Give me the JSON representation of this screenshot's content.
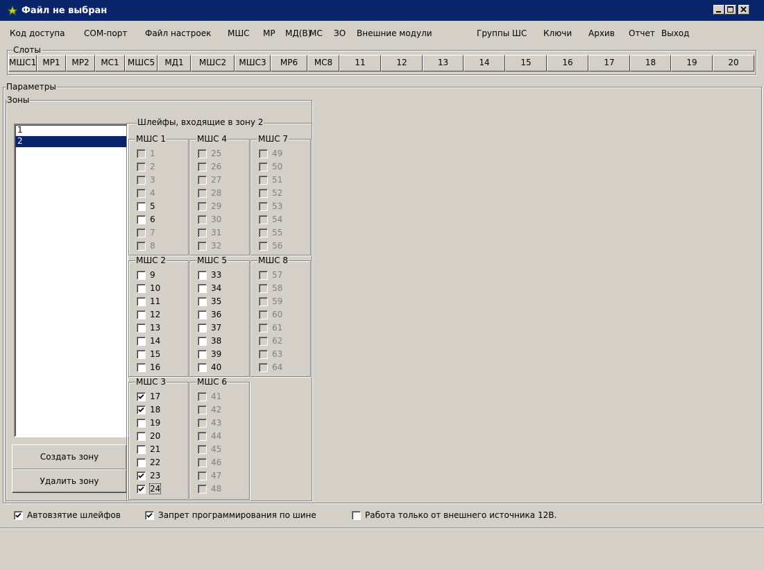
{
  "window": {
    "title": "Файл не выбран"
  },
  "menu": [
    "Код доступа",
    "COM-порт",
    "Файл настроек",
    "МШС",
    "МР",
    "МД(В)",
    "МС",
    "ЗО",
    "Внешние модули",
    "Группы ШС",
    "Ключи",
    "Архив",
    "Отчет",
    "Выход"
  ],
  "slots_title": "Слоты",
  "slots": [
    "МШС1",
    "МР1",
    "МР2",
    "МС1",
    "МШС5",
    "МД1",
    "МШС2",
    "МШС3",
    "МР6",
    "МС8",
    "11",
    "12",
    "13",
    "14",
    "15",
    "16",
    "17",
    "18",
    "19",
    "20"
  ],
  "params_title": "Параметры",
  "zones_title": "Зоны",
  "zone_list": {
    "items": [
      "1",
      "2"
    ],
    "selected": 1
  },
  "create_zone": "Создать зону",
  "delete_zone": "Удалить зону",
  "loops_title": "Шлейфы, входящие в зону 2",
  "modules": [
    {
      "name": "МШС 1",
      "loops": [
        {
          "n": "1",
          "enabled": false,
          "checked": false
        },
        {
          "n": "2",
          "enabled": false,
          "checked": false
        },
        {
          "n": "3",
          "enabled": false,
          "checked": false
        },
        {
          "n": "4",
          "enabled": false,
          "checked": false
        },
        {
          "n": "5",
          "enabled": true,
          "checked": false
        },
        {
          "n": "6",
          "enabled": true,
          "checked": false
        },
        {
          "n": "7",
          "enabled": false,
          "checked": false
        },
        {
          "n": "8",
          "enabled": false,
          "checked": false
        }
      ]
    },
    {
      "name": "МШС 4",
      "loops": [
        {
          "n": "25",
          "enabled": false,
          "checked": false
        },
        {
          "n": "26",
          "enabled": false,
          "checked": false
        },
        {
          "n": "27",
          "enabled": false,
          "checked": false
        },
        {
          "n": "28",
          "enabled": false,
          "checked": false
        },
        {
          "n": "29",
          "enabled": false,
          "checked": false
        },
        {
          "n": "30",
          "enabled": false,
          "checked": false
        },
        {
          "n": "31",
          "enabled": false,
          "checked": false
        },
        {
          "n": "32",
          "enabled": false,
          "checked": false
        }
      ]
    },
    {
      "name": "МШС 7",
      "loops": [
        {
          "n": "49",
          "enabled": false,
          "checked": false
        },
        {
          "n": "50",
          "enabled": false,
          "checked": false
        },
        {
          "n": "51",
          "enabled": false,
          "checked": false
        },
        {
          "n": "52",
          "enabled": false,
          "checked": false
        },
        {
          "n": "53",
          "enabled": false,
          "checked": false
        },
        {
          "n": "54",
          "enabled": false,
          "checked": false
        },
        {
          "n": "55",
          "enabled": false,
          "checked": false
        },
        {
          "n": "56",
          "enabled": false,
          "checked": false
        }
      ]
    },
    {
      "name": "МШС 2",
      "loops": [
        {
          "n": "9",
          "enabled": true,
          "checked": false
        },
        {
          "n": "10",
          "enabled": true,
          "checked": false
        },
        {
          "n": "11",
          "enabled": true,
          "checked": false
        },
        {
          "n": "12",
          "enabled": true,
          "checked": false
        },
        {
          "n": "13",
          "enabled": true,
          "checked": false
        },
        {
          "n": "14",
          "enabled": true,
          "checked": false
        },
        {
          "n": "15",
          "enabled": true,
          "checked": false
        },
        {
          "n": "16",
          "enabled": true,
          "checked": false
        }
      ]
    },
    {
      "name": "МШС 5",
      "loops": [
        {
          "n": "33",
          "enabled": true,
          "checked": false
        },
        {
          "n": "34",
          "enabled": true,
          "checked": false
        },
        {
          "n": "35",
          "enabled": true,
          "checked": false
        },
        {
          "n": "36",
          "enabled": true,
          "checked": false
        },
        {
          "n": "37",
          "enabled": true,
          "checked": false
        },
        {
          "n": "38",
          "enabled": true,
          "checked": false
        },
        {
          "n": "39",
          "enabled": true,
          "checked": false
        },
        {
          "n": "40",
          "enabled": true,
          "checked": false
        }
      ]
    },
    {
      "name": "МШС 8",
      "loops": [
        {
          "n": "57",
          "enabled": false,
          "checked": false
        },
        {
          "n": "58",
          "enabled": false,
          "checked": false
        },
        {
          "n": "59",
          "enabled": false,
          "checked": false
        },
        {
          "n": "60",
          "enabled": false,
          "checked": false
        },
        {
          "n": "61",
          "enabled": false,
          "checked": false
        },
        {
          "n": "62",
          "enabled": false,
          "checked": false
        },
        {
          "n": "63",
          "enabled": false,
          "checked": false
        },
        {
          "n": "64",
          "enabled": false,
          "checked": false
        }
      ]
    },
    {
      "name": "МШС 3",
      "loops": [
        {
          "n": "17",
          "enabled": true,
          "checked": true
        },
        {
          "n": "18",
          "enabled": true,
          "checked": true
        },
        {
          "n": "19",
          "enabled": true,
          "checked": false
        },
        {
          "n": "20",
          "enabled": true,
          "checked": false
        },
        {
          "n": "21",
          "enabled": true,
          "checked": false
        },
        {
          "n": "22",
          "enabled": true,
          "checked": false
        },
        {
          "n": "23",
          "enabled": true,
          "checked": true
        },
        {
          "n": "24",
          "enabled": true,
          "checked": true,
          "focused": true
        }
      ]
    },
    {
      "name": "МШС 6",
      "loops": [
        {
          "n": "41",
          "enabled": false,
          "checked": false
        },
        {
          "n": "42",
          "enabled": false,
          "checked": false
        },
        {
          "n": "43",
          "enabled": false,
          "checked": false
        },
        {
          "n": "44",
          "enabled": false,
          "checked": false
        },
        {
          "n": "45",
          "enabled": false,
          "checked": false
        },
        {
          "n": "46",
          "enabled": false,
          "checked": false
        },
        {
          "n": "47",
          "enabled": false,
          "checked": false
        },
        {
          "n": "48",
          "enabled": false,
          "checked": false
        }
      ]
    }
  ],
  "options": [
    {
      "label": "Автовзятие шлейфов",
      "checked": true
    },
    {
      "label": "Запрет программирования по шине",
      "checked": true
    },
    {
      "label": "Работа только от внешнего источника 12В.",
      "checked": false
    }
  ]
}
